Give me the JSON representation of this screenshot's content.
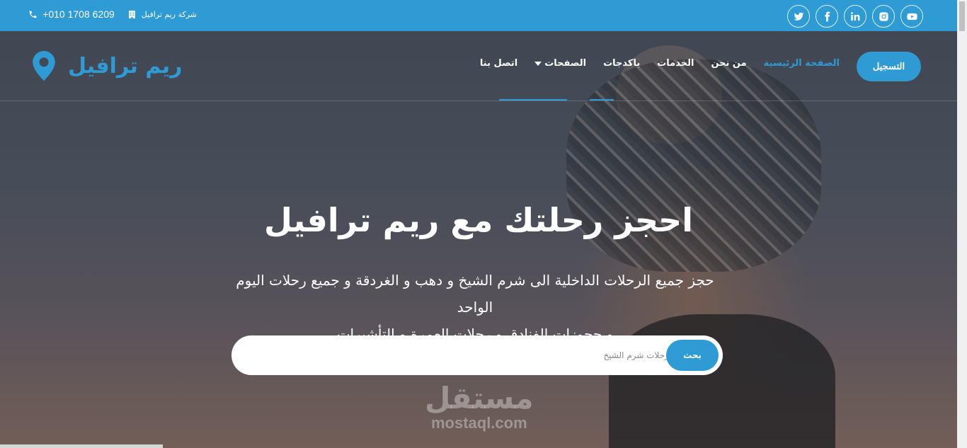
{
  "topbar": {
    "phone": "+010 1708 6209",
    "company": "شركة ريم ترافيل",
    "social": [
      "twitter-icon",
      "facebook-icon",
      "linkedin-icon",
      "instagram-icon",
      "youtube-icon"
    ]
  },
  "navbar": {
    "brand": "ريم ترافيل",
    "register_label": "التسجيل",
    "items": [
      {
        "label": "الصفحة الرئيسية",
        "active": true
      },
      {
        "label": "من نحن",
        "active": false
      },
      {
        "label": "الخدمات",
        "active": false
      },
      {
        "label": "باكدجات",
        "active": false
      },
      {
        "label": "الصفحات",
        "active": false,
        "dropdown": true
      },
      {
        "label": "اتصل بنا",
        "active": false
      }
    ]
  },
  "hero": {
    "headline": "احجز رحلتك مع ريم ترافيل",
    "subtext_line1": "حجز جميع الرحلات الداخلية الى شرم الشيخ و دهب و الغردقة و جميع رحلات اليوم الواحد",
    "subtext_line2": "و حجوزات الفنادق و رحلات العمرة و التأشيرات"
  },
  "search": {
    "placeholder": "مثال : رحلات شرم الشيخ",
    "button_label": "بحث"
  },
  "watermark": {
    "arabic": "مستقل",
    "latin": "mostaql.com"
  },
  "colors": {
    "accent": "#2e9bd4",
    "topbar": "#2e9bd4"
  }
}
